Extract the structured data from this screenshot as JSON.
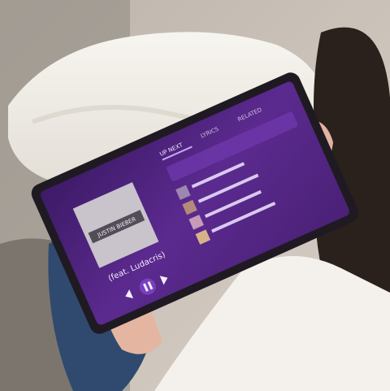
{
  "photo": {
    "colors": {
      "background": "#c9c1b8",
      "blanket": "#f2efe9",
      "sofa": "#8e8780",
      "jeans": "#2f4a6e",
      "sweater": "#f4f1ec",
      "hair": "#2a211c",
      "mug": "#e9b8b1",
      "tablet_frame": "#1f1a22",
      "screen_purple": "#5b2a8f",
      "screen_purple_dark": "#3b1860"
    }
  },
  "tablet": {
    "tabs": [
      "UP NEXT",
      "LYRICS",
      "RELATED"
    ],
    "track": {
      "title": "(feat. Ludacris)",
      "album_art_text": "JUSTIN BIEBER"
    },
    "icons": [
      "previous-icon",
      "pause-icon",
      "next-icon",
      "heart-icon",
      "more-icon"
    ]
  }
}
